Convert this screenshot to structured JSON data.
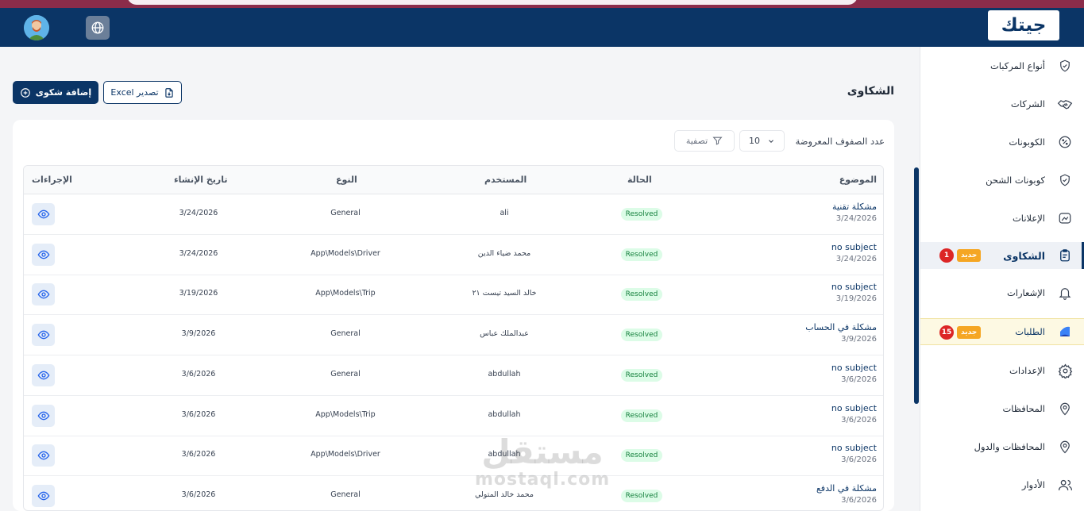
{
  "header": {
    "logo_text": "جيتك",
    "avatar_icon": "user-avatar",
    "language_icon": "globe-icon"
  },
  "sidebar": {
    "items": [
      {
        "label": "أنواع المركبات",
        "icon": "shield-check-icon"
      },
      {
        "label": "الشركات",
        "icon": "handshake-icon"
      },
      {
        "label": "الكوبونات",
        "icon": "discount-icon"
      },
      {
        "label": "كوبونات الشحن",
        "icon": "shield-check-icon"
      },
      {
        "label": "الإعلانات",
        "icon": "ads-icon"
      },
      {
        "label": "الشكاوى",
        "icon": "clipboard-icon",
        "active": true,
        "new_badge": "جديد",
        "count": "1"
      },
      {
        "label": "الإشعارات",
        "icon": "bell-icon"
      },
      {
        "label": "الطلبات",
        "icon": "orders-icon",
        "new_badge": "جديد",
        "count": "15"
      },
      {
        "label": "الإعدادات",
        "icon": "gear-icon"
      },
      {
        "label": "المحافظات",
        "icon": "location-pin-icon"
      },
      {
        "label": "المحافظات والدول",
        "icon": "location-pin-icon"
      },
      {
        "label": "الأدوار",
        "icon": "users-icon"
      }
    ]
  },
  "page": {
    "title": "الشكاوى",
    "add_button": "إضافة شكوى",
    "export_button": "تصدير Excel",
    "rows_label": "عدد الصفوف المعروضة",
    "rows_value": "10",
    "filter_button": "تصفية"
  },
  "table": {
    "headers": {
      "subject": "الموضوع",
      "status": "الحالة",
      "user": "المستخدم",
      "type": "النوع",
      "created": "تاريخ الإنشاء",
      "actions": "الإجراءات"
    },
    "rows": [
      {
        "subject": "مشكلة تقنية",
        "subject_date": "3/24/2026",
        "status": "Resolved",
        "user": "ali",
        "type": "General",
        "created": "3/24/2026"
      },
      {
        "subject": "no subject",
        "subject_date": "3/24/2026",
        "status": "Resolved",
        "user": "محمد ضياء الدين",
        "type": "App\\Models\\Driver",
        "created": "3/24/2026"
      },
      {
        "subject": "no subject",
        "subject_date": "3/19/2026",
        "status": "Resolved",
        "user": "خالد السيد تيست ٢١",
        "type": "App\\Models\\Trip",
        "created": "3/19/2026"
      },
      {
        "subject": "مشكلة في الحساب",
        "subject_date": "3/9/2026",
        "status": "Resolved",
        "user": "عبدالملك عباس",
        "type": "General",
        "created": "3/9/2026"
      },
      {
        "subject": "no subject",
        "subject_date": "3/6/2026",
        "status": "Resolved",
        "user": "abdullah",
        "type": "General",
        "created": "3/6/2026"
      },
      {
        "subject": "no subject",
        "subject_date": "3/6/2026",
        "status": "Resolved",
        "user": "abdullah",
        "type": "App\\Models\\Trip",
        "created": "3/6/2026"
      },
      {
        "subject": "no subject",
        "subject_date": "3/6/2026",
        "status": "Resolved",
        "user": "abdullah",
        "type": "App\\Models\\Driver",
        "created": "3/6/2026"
      },
      {
        "subject": "مشكلة في الدفع",
        "subject_date": "3/6/2026",
        "status": "Resolved",
        "user": "محمد خالد المتولي",
        "type": "General",
        "created": "3/6/2026"
      }
    ]
  },
  "watermark": {
    "arabic": "مستقل",
    "latin": "mostaql.com"
  },
  "colors": {
    "primary": "#0b3566",
    "status_green": "#15803d",
    "badge_orange": "#f5a623",
    "badge_red": "#dc2626"
  }
}
